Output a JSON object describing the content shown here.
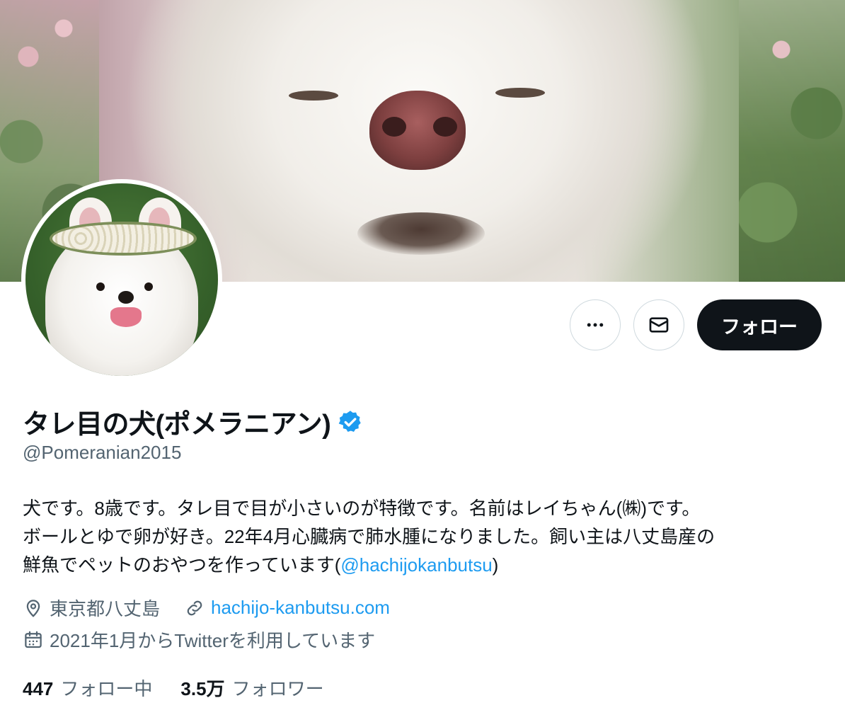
{
  "profile": {
    "display_name": "タレ目の犬(ポメラニアン)",
    "handle": "@Pomeranian2015",
    "verified": true
  },
  "actions": {
    "more_icon": "more-horizontal-icon",
    "message_icon": "envelope-icon",
    "follow_label": "フォロー"
  },
  "bio": {
    "line1": "犬です。8歳です。タレ目で目が小さいのが特徴です。名前はレイちゃん(㈱)です。",
    "line2": "ボールとゆで卵が好き。22年4月心臓病で肺水腫になりました。飼い主は八丈島産の",
    "line3_prefix": "鮮魚でペットのおやつを作っています(",
    "line3_mention": "@hachijokanbutsu",
    "line3_suffix": ")"
  },
  "meta": {
    "location": "東京都八丈島",
    "website": "hachijo-kanbutsu.com",
    "joined": "2021年1月からTwitterを利用しています"
  },
  "stats": {
    "following_count": "447",
    "following_label": "フォロー中",
    "followers_count": "3.5万",
    "followers_label": "フォロワー"
  },
  "colors": {
    "accent": "#1d9bf0",
    "text": "#0f1419",
    "secondary": "#536471",
    "border": "#cfd9de"
  }
}
